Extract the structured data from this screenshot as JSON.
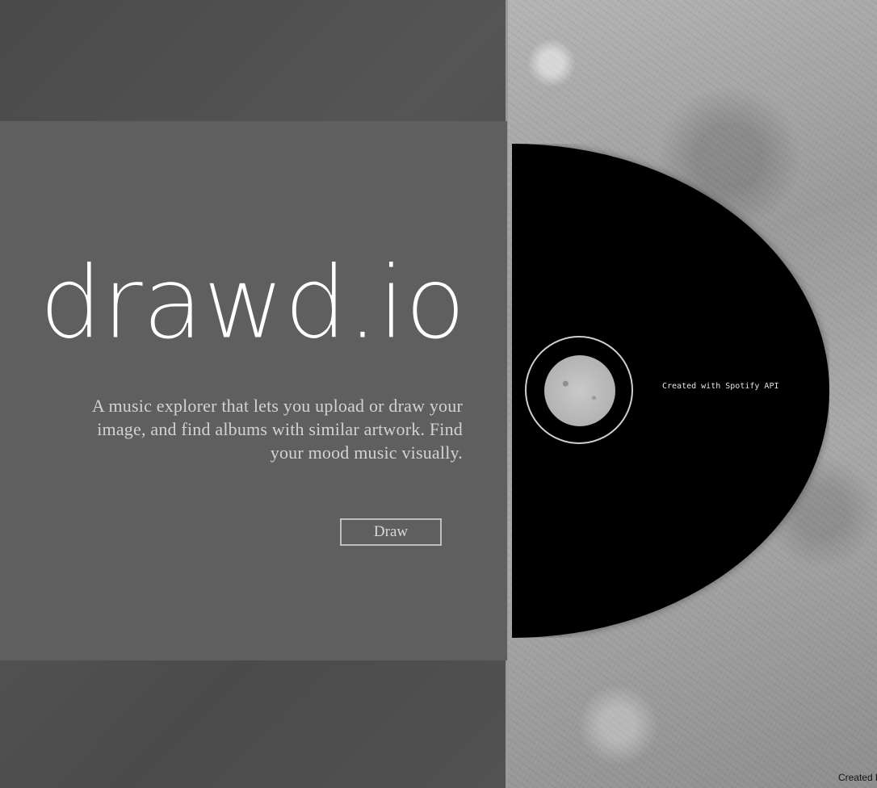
{
  "hero": {
    "logo": "drawd.io",
    "tagline": "A music explorer that lets you upload or draw your image, and find albums with similar artwork. Find your mood music visually.",
    "button_label": "Draw"
  },
  "disc": {
    "credit": "Created with Spotify API"
  },
  "footer": {
    "author_credit": "Created by S"
  }
}
